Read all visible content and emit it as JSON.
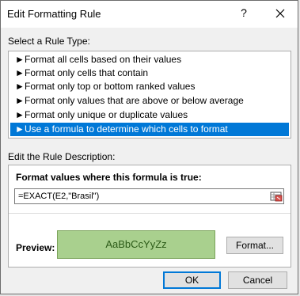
{
  "window": {
    "title": "Edit Formatting Rule",
    "help_glyph": "?",
    "close_icon": "close-icon"
  },
  "ruletype": {
    "label": "Select a Rule Type:",
    "items": [
      "Format all cells based on their values",
      "Format only cells that contain",
      "Format only top or bottom ranked values",
      "Format only values that are above or below average",
      "Format only unique or duplicate values",
      "Use a formula to determine which cells to format"
    ],
    "selected_index": 5,
    "bullet": "►"
  },
  "description": {
    "label": "Edit the Rule Description:",
    "formula_label": "Format values where this formula is true:",
    "formula_value": "=EXACT(E2,\"Brasil\")",
    "preview_label": "Preview:",
    "preview_sample": "AaBbCcYyZz",
    "format_button": "Format..."
  },
  "buttons": {
    "ok": "OK",
    "cancel": "Cancel"
  },
  "colors": {
    "selected": "#0078d7",
    "preview_fill": "#a9d08e"
  }
}
